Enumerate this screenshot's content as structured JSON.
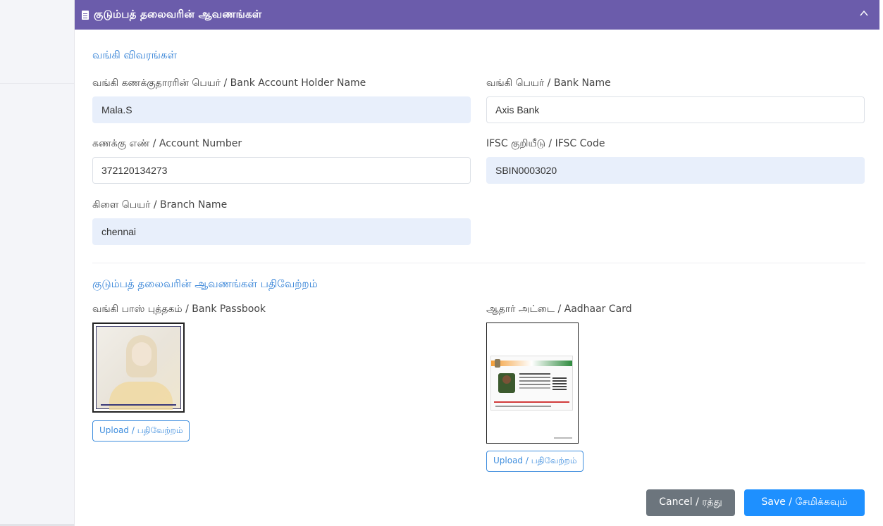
{
  "header": {
    "title": "குடும்பத் தலைவரின் ஆவணங்கள்",
    "doc_icon": "document-icon",
    "collapse_icon": "chevron-up-icon"
  },
  "bank_section": {
    "title": "வங்கி விவரங்கள்",
    "account_holder": {
      "label": "வங்கி கணக்குதாரரின் பெயர் / Bank Account Holder Name",
      "value": "Mala.S"
    },
    "bank_name": {
      "label": "வங்கி பெயர் / Bank Name",
      "value": "Axis Bank"
    },
    "account_number": {
      "label": "கணக்கு எண் / Account Number",
      "value": "372120134273"
    },
    "ifsc": {
      "label": "IFSC குறியீடு / IFSC Code",
      "value": "SBIN0003020"
    },
    "branch": {
      "label": "கிளை பெயர் / Branch Name",
      "value": "chennai"
    }
  },
  "upload_section": {
    "title": "குடும்பத் தலைவரின் ஆவணங்கள் பதிவேற்றம்",
    "passbook": {
      "label": "வங்கி பாஸ் புத்தகம் / Bank Passbook",
      "upload_label": "Upload / பதிவேற்றம்"
    },
    "aadhaar": {
      "label": "ஆதார் அட்டை / Aadhaar Card",
      "upload_label": "Upload / பதிவேற்றம்"
    }
  },
  "actions": {
    "cancel_label": "Cancel / ரத்து",
    "save_label": "Save / சேமிக்கவும்"
  },
  "colors": {
    "header_bg": "#6b5cab",
    "accent_blue": "#2f7fd6",
    "filled_input_bg": "#e8effb",
    "cancel_bg": "#6c757d",
    "save_bg": "#1e90ff"
  }
}
